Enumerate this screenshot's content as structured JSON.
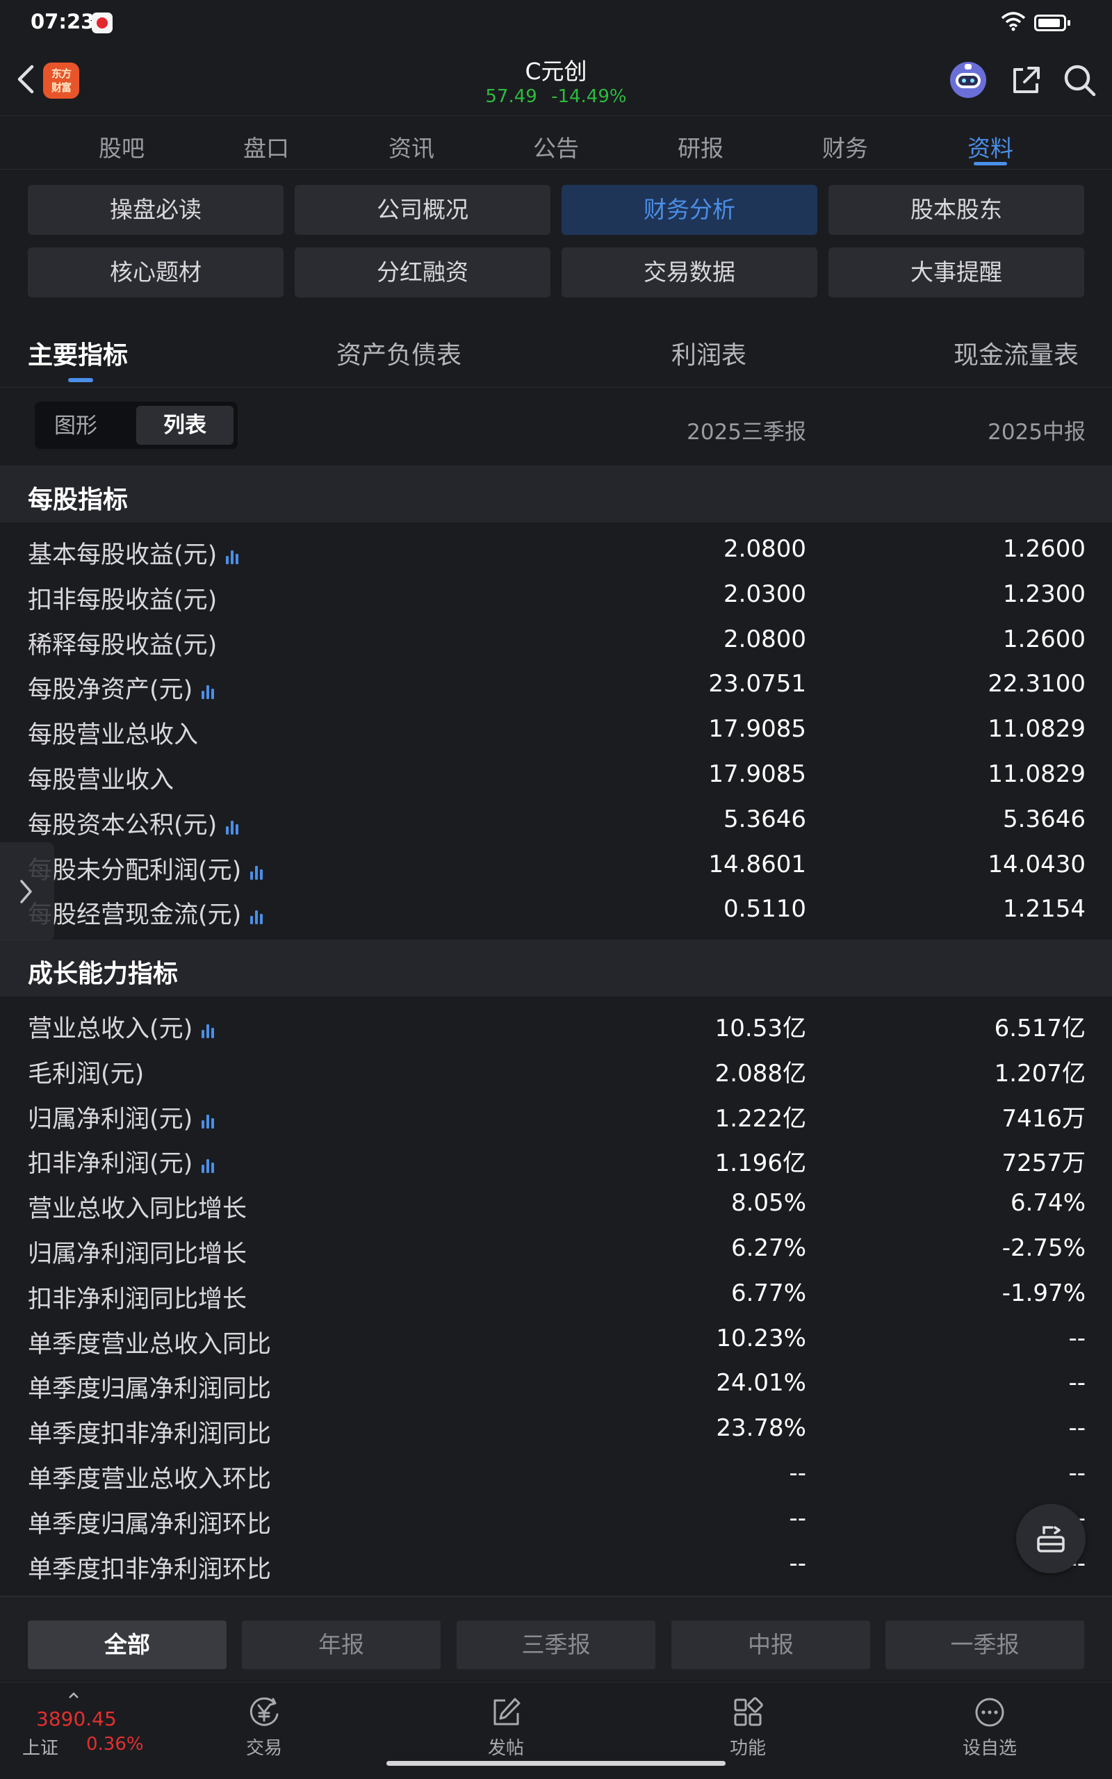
{
  "status_bar": {
    "time": "07:23"
  },
  "header": {
    "logo_text_line1": "东方",
    "logo_text_line2": "财富",
    "stock_name": "C元创",
    "price": "57.49",
    "change_pct": "-14.49%",
    "quote_color": "#2dbb3e"
  },
  "main_tabs": [
    "股吧",
    "盘口",
    "资讯",
    "公告",
    "研报",
    "财务",
    "资料"
  ],
  "active_main_tab": "资料",
  "grid_buttons": [
    "操盘必读",
    "公司概况",
    "财务分析",
    "股本股东",
    "核心题材",
    "分红融资",
    "交易数据",
    "大事提醒"
  ],
  "active_grid_button": "财务分析",
  "sub_tabs": [
    "主要指标",
    "资产负债表",
    "利润表",
    "现金流量表"
  ],
  "active_sub_tab": "主要指标",
  "view_toggle": {
    "graph": "图形",
    "list": "列表"
  },
  "columns": [
    "2025三季报",
    "2025中报"
  ],
  "sections": [
    {
      "title": "每股指标",
      "rows": [
        {
          "label": "基本每股收益(元)",
          "chart": true,
          "v1": "2.0800",
          "v2": "1.2600"
        },
        {
          "label": "扣非每股收益(元)",
          "chart": false,
          "v1": "2.0300",
          "v2": "1.2300"
        },
        {
          "label": "稀释每股收益(元)",
          "chart": false,
          "v1": "2.0800",
          "v2": "1.2600"
        },
        {
          "label": "每股净资产(元)",
          "chart": true,
          "v1": "23.0751",
          "v2": "22.3100"
        },
        {
          "label": "每股营业总收入",
          "chart": false,
          "v1": "17.9085",
          "v2": "11.0829"
        },
        {
          "label": "每股营业收入",
          "chart": false,
          "v1": "17.9085",
          "v2": "11.0829"
        },
        {
          "label": "每股资本公积(元)",
          "chart": true,
          "v1": "5.3646",
          "v2": "5.3646"
        },
        {
          "label": "每股未分配利润(元)",
          "chart": true,
          "v1": "14.8601",
          "v2": "14.0430"
        },
        {
          "label": "每股经营现金流(元)",
          "chart": true,
          "v1": "0.5110",
          "v2": "1.2154"
        }
      ]
    },
    {
      "title": "成长能力指标",
      "rows": [
        {
          "label": "营业总收入(元)",
          "chart": true,
          "v1": "10.53亿",
          "v2": "6.517亿"
        },
        {
          "label": "毛利润(元)",
          "chart": false,
          "v1": "2.088亿",
          "v2": "1.207亿"
        },
        {
          "label": "归属净利润(元)",
          "chart": true,
          "v1": "1.222亿",
          "v2": "7416万"
        },
        {
          "label": "扣非净利润(元)",
          "chart": true,
          "v1": "1.196亿",
          "v2": "7257万"
        },
        {
          "label": "营业总收入同比增长",
          "chart": false,
          "v1": "8.05%",
          "v2": "6.74%"
        },
        {
          "label": "归属净利润同比增长",
          "chart": false,
          "v1": "6.27%",
          "v2": "-2.75%"
        },
        {
          "label": "扣非净利润同比增长",
          "chart": false,
          "v1": "6.77%",
          "v2": "-1.97%"
        },
        {
          "label": "单季度营业总收入同比",
          "chart": false,
          "v1": "10.23%",
          "v2": "--"
        },
        {
          "label": "单季度归属净利润同比",
          "chart": false,
          "v1": "24.01%",
          "v2": "--"
        },
        {
          "label": "单季度扣非净利润同比",
          "chart": false,
          "v1": "23.78%",
          "v2": "--"
        },
        {
          "label": "单季度营业总收入环比",
          "chart": false,
          "v1": "--",
          "v2": "--"
        },
        {
          "label": "单季度归属净利润环比",
          "chart": false,
          "v1": "--",
          "v2": "--"
        },
        {
          "label": "单季度扣非净利润环比",
          "chart": false,
          "v1": "--",
          "v2": "--"
        }
      ]
    }
  ],
  "period_buttons": [
    "全部",
    "年报",
    "三季报",
    "中报",
    "一季报"
  ],
  "active_period": "全部",
  "bottom_nav": {
    "index_value": "3890.45",
    "index_name": "上证",
    "index_change": "0.36%",
    "items": [
      {
        "label": "交易",
        "icon": "yen-circle-icon"
      },
      {
        "label": "发帖",
        "icon": "edit-icon"
      },
      {
        "label": "功能",
        "icon": "grid-icon"
      },
      {
        "label": "设自选",
        "icon": "chat-dots-icon"
      }
    ]
  },
  "colors": {
    "accent": "#4a8fe8",
    "down": "#2dbb3e",
    "up": "#e3302e",
    "background": "#1b1c20"
  }
}
